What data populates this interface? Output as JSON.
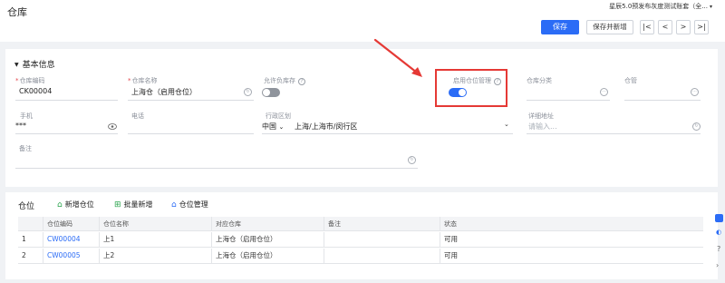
{
  "header": {
    "title": "仓库",
    "org_select": "星辰5.0预发布灰度测试账套（全...",
    "save_label": "保存",
    "save_new_label": "保存并新增",
    "nav": {
      "first": "|<",
      "prev": "<",
      "next": ">",
      "last": ">|"
    }
  },
  "basic": {
    "section_title": "基本信息",
    "fields": {
      "code": {
        "label": "仓库编码",
        "value": "CK00004"
      },
      "name": {
        "label": "仓库名称",
        "value": "上海仓（启用仓位）"
      },
      "allow_negative": {
        "label": "允许负库存",
        "value": "关"
      },
      "enable_position": {
        "label": "启用仓位管理",
        "value": "开"
      },
      "category": {
        "label": "仓库分类",
        "value": ""
      },
      "manager": {
        "label": "仓管",
        "value": ""
      },
      "phone": {
        "label": "手机",
        "value": "***"
      },
      "tel": {
        "label": "电话",
        "value": ""
      },
      "region": {
        "label": "行政区划",
        "country": "中国",
        "value": "上海/上海市/闵行区"
      },
      "address": {
        "label": "详细地址",
        "placeholder": "请输入..."
      },
      "remark": {
        "label": "备注",
        "value": ""
      }
    }
  },
  "positions": {
    "title": "仓位",
    "tools": {
      "add": "新增仓位",
      "batch": "批量新增",
      "manage": "仓位管理"
    },
    "columns": [
      "",
      "仓位编码",
      "仓位名称",
      "对应仓库",
      "备注",
      "状态"
    ],
    "rows": [
      {
        "no": "1",
        "code": "CW00004",
        "name": "上1",
        "warehouse": "上海仓（启用仓位）",
        "remark": "",
        "status": "可用"
      },
      {
        "no": "2",
        "code": "CW00005",
        "name": "上2",
        "warehouse": "上海仓（启用仓位）",
        "remark": "",
        "status": "可用"
      }
    ]
  },
  "colors": {
    "primary": "#2b6cf6",
    "annotation": "#e53935",
    "toggle_off": "#8f949c"
  },
  "icons": [
    "help-icon",
    "refresh-icon",
    "eye-icon",
    "more-icon",
    "chevron-down-icon",
    "add-icon",
    "batch-add-icon",
    "manage-icon",
    "arrow-annotation"
  ]
}
